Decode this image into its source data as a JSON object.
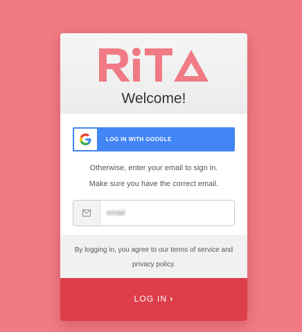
{
  "brand": {
    "logo_text": "RiTA",
    "accent_color": "#f07b84",
    "button_color": "#dd3e4a",
    "google_color": "#4285f4"
  },
  "header": {
    "title": "Welcome!"
  },
  "google_button": {
    "label": "LOG IN WITH GOOGLE",
    "icon": "google-g-icon"
  },
  "instructions": {
    "line1": "Otherwise, enter your email to sign in.",
    "line2": "Make sure you have the correct email."
  },
  "email_field": {
    "icon": "envelope-icon",
    "value": "email"
  },
  "terms": {
    "line1": "By logging in, you agree to our terms of service and",
    "line2": "privacy policy."
  },
  "login_button": {
    "label": "LOG IN",
    "chevron": "›"
  }
}
